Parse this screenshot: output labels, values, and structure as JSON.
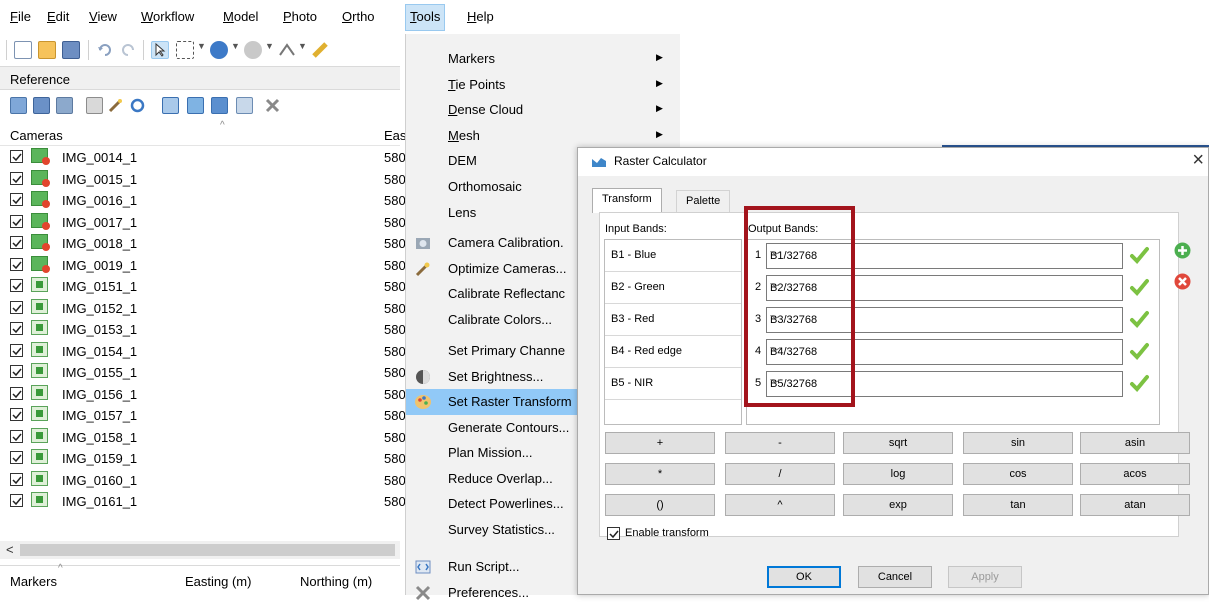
{
  "menubar": {
    "items": [
      {
        "accel": "F",
        "rest": "ile"
      },
      {
        "accel": "E",
        "rest": "dit"
      },
      {
        "accel": "V",
        "rest": "iew"
      },
      {
        "accel": "W",
        "rest": "orkflow"
      },
      {
        "accel": "M",
        "rest": "odel"
      },
      {
        "accel": "P",
        "rest": "hoto"
      },
      {
        "accel": "O",
        "rest": "rtho"
      },
      {
        "accel": "T",
        "rest": "ools"
      },
      {
        "accel": "H",
        "rest": "elp"
      }
    ]
  },
  "reference_pane": {
    "title": "Reference",
    "columns": {
      "cameras": "Cameras",
      "easting": "Eas"
    },
    "cameras": [
      {
        "name": "IMG_0014_1",
        "easting": "580",
        "status": "error"
      },
      {
        "name": "IMG_0015_1",
        "easting": "580",
        "status": "error"
      },
      {
        "name": "IMG_0016_1",
        "easting": "580",
        "status": "error"
      },
      {
        "name": "IMG_0017_1",
        "easting": "580",
        "status": "error"
      },
      {
        "name": "IMG_0018_1",
        "easting": "580",
        "status": "error"
      },
      {
        "name": "IMG_0019_1",
        "easting": "580",
        "status": "error"
      },
      {
        "name": "IMG_0151_1",
        "easting": "580",
        "status": "ok"
      },
      {
        "name": "IMG_0152_1",
        "easting": "580",
        "status": "ok"
      },
      {
        "name": "IMG_0153_1",
        "easting": "580",
        "status": "ok"
      },
      {
        "name": "IMG_0154_1",
        "easting": "580",
        "status": "ok"
      },
      {
        "name": "IMG_0155_1",
        "easting": "580",
        "status": "ok"
      },
      {
        "name": "IMG_0156_1",
        "easting": "580",
        "status": "ok"
      },
      {
        "name": "IMG_0157_1",
        "easting": "580",
        "status": "ok"
      },
      {
        "name": "IMG_0158_1",
        "easting": "580",
        "status": "ok"
      },
      {
        "name": "IMG_0159_1",
        "easting": "580",
        "status": "ok"
      },
      {
        "name": "IMG_0160_1",
        "easting": "580",
        "status": "ok"
      },
      {
        "name": "IMG_0161_1",
        "easting": "580",
        "status": "ok"
      }
    ],
    "scroll_left_arrow": "<",
    "markers_header": {
      "markers": "Markers",
      "easting": "Easting (m)",
      "northing": "Northing (m)"
    }
  },
  "tools_menu": {
    "items": [
      {
        "accel": "",
        "label": "Markers",
        "submenu": true
      },
      {
        "accel": "T",
        "label": "ie Points",
        "submenu": true
      },
      {
        "accel": "D",
        "label": "ense Cloud",
        "submenu": true
      },
      {
        "accel": "M",
        "label": "esh",
        "submenu": true
      },
      {
        "accel": "",
        "label": "DEM",
        "submenu": false
      },
      {
        "accel": "",
        "label": "Orthomosaic",
        "submenu": false
      },
      {
        "accel": "",
        "label": "Lens",
        "submenu": false
      },
      {
        "accel": "",
        "label": "Camera Calibration.",
        "submenu": false,
        "icon": "camera-icon"
      },
      {
        "accel": "",
        "label": "Optimize Cameras...",
        "submenu": false,
        "icon": "wand-icon"
      },
      {
        "accel": "",
        "label": "Calibrate Reflectanc",
        "submenu": false
      },
      {
        "accel": "",
        "label": "Calibrate Colors...",
        "submenu": false
      },
      {
        "accel": "",
        "label": "Set Primary Channe",
        "submenu": false
      },
      {
        "accel": "",
        "label": "Set Brightness...",
        "submenu": false,
        "icon": "brightness-icon"
      },
      {
        "accel": "",
        "label": "Set Raster Transform",
        "submenu": false,
        "icon": "palette-icon",
        "hover": true
      },
      {
        "accel": "",
        "label": "Generate Contours...",
        "submenu": false
      },
      {
        "accel": "",
        "label": "Plan Mission...",
        "submenu": false
      },
      {
        "accel": "",
        "label": "Reduce Overlap...",
        "submenu": false
      },
      {
        "accel": "",
        "label": "Detect Powerlines...",
        "submenu": false
      },
      {
        "accel": "",
        "label": "Survey Statistics...",
        "submenu": false
      },
      {
        "accel": "",
        "label": "Run Script...",
        "submenu": false,
        "icon": "script-icon"
      },
      {
        "accel": "",
        "label": "Preferences...",
        "submenu": false,
        "icon": "tools-icon"
      }
    ]
  },
  "dialog": {
    "title": "Raster Calculator",
    "close_glyph": "×",
    "tabs": [
      "Transform",
      "Palette"
    ],
    "input_label": "Input Bands:",
    "output_label": "Output Bands:",
    "input_bands": [
      "B1 - Blue",
      "B2 - Green",
      "B3 - Red",
      "B4 - Red edge",
      "B5 - NIR"
    ],
    "output_bands": [
      {
        "num": "1",
        "expr": "B1/32768"
      },
      {
        "num": "2",
        "expr": "B2/32768"
      },
      {
        "num": "3",
        "expr": "B3/32768"
      },
      {
        "num": "4",
        "expr": "B4/32768"
      },
      {
        "num": "5",
        "expr": "B5/32768"
      }
    ],
    "operators": [
      [
        "+",
        "-",
        "sqrt",
        "sin",
        "asin"
      ],
      [
        "*",
        "/",
        "log",
        "cos",
        "acos"
      ],
      [
        "()",
        "^",
        "exp",
        "tan",
        "atan"
      ]
    ],
    "enable_transform": "Enable transform",
    "buttons": {
      "ok": "OK",
      "cancel": "Cancel",
      "apply": "Apply"
    },
    "highlight_color": "#a3141c"
  }
}
